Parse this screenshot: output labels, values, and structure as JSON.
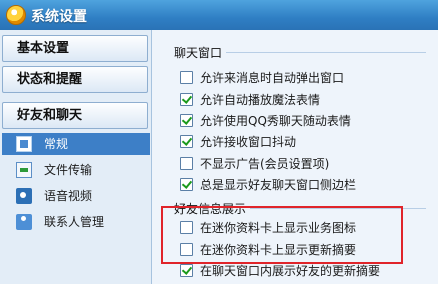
{
  "window": {
    "title": "系统设置"
  },
  "sidebar": {
    "groups": [
      {
        "label": "基本设置"
      },
      {
        "label": "状态和提醒"
      },
      {
        "label": "好友和聊天"
      }
    ],
    "items": [
      {
        "label": "常规",
        "icon": "general-icon",
        "selected": true
      },
      {
        "label": "文件传输",
        "icon": "file-transfer-icon"
      },
      {
        "label": "语音视频",
        "icon": "audio-video-icon"
      },
      {
        "label": "联系人管理",
        "icon": "contacts-icon"
      }
    ]
  },
  "chat_window": {
    "title": "聊天窗口",
    "options": [
      {
        "label": "允许来消息时自动弹出窗口",
        "checked": false
      },
      {
        "label": "允许自动播放魔法表情",
        "checked": true
      },
      {
        "label": "允许使用QQ秀聊天随动表情",
        "checked": true
      },
      {
        "label": "允许接收窗口抖动",
        "checked": true
      },
      {
        "label": "不显示广告(会员设置项)",
        "checked": false
      },
      {
        "label": "总是显示好友聊天窗口侧边栏",
        "checked": true
      }
    ]
  },
  "friend_info": {
    "title": "好友信息展示",
    "options": [
      {
        "label": "在迷你资料卡上显示业务图标",
        "checked": false
      },
      {
        "label": "在迷你资料卡上显示更新摘要",
        "checked": false
      },
      {
        "label": "在聊天窗口内展示好友的更新摘要",
        "checked": true
      }
    ]
  },
  "colors": {
    "accent": "#3d7fc7",
    "highlight_border": "#e0242a",
    "check": "#1b9a1b"
  }
}
